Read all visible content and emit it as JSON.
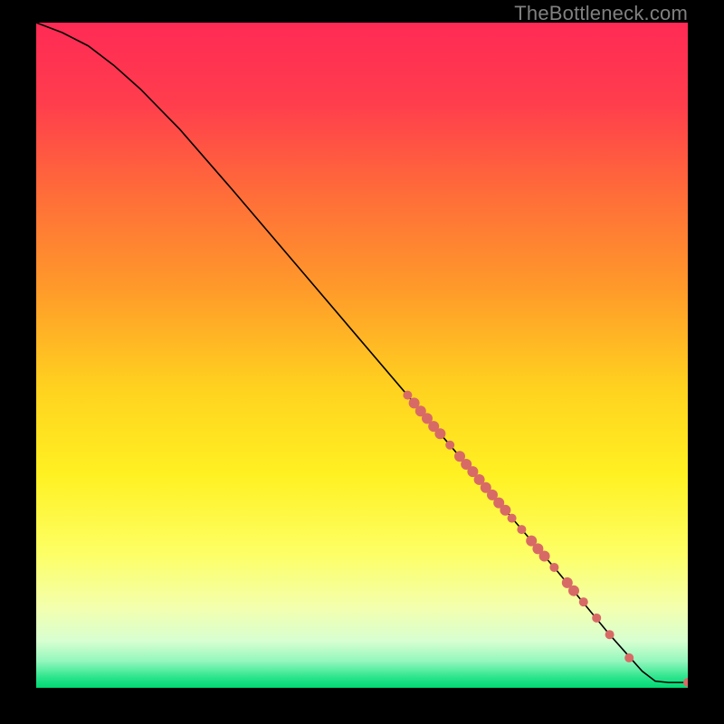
{
  "watermark": "TheBottleneck.com",
  "chart_data": {
    "type": "line",
    "xlim": [
      0,
      100
    ],
    "ylim": [
      0,
      100
    ],
    "title": "",
    "xlabel": "",
    "ylabel": "",
    "curve": [
      {
        "x": 0,
        "y": 100
      },
      {
        "x": 4,
        "y": 98.5
      },
      {
        "x": 8,
        "y": 96.5
      },
      {
        "x": 12,
        "y": 93.5
      },
      {
        "x": 16,
        "y": 90.0
      },
      {
        "x": 22,
        "y": 84.0
      },
      {
        "x": 30,
        "y": 75.0
      },
      {
        "x": 40,
        "y": 63.5
      },
      {
        "x": 50,
        "y": 52.0
      },
      {
        "x": 60,
        "y": 40.5
      },
      {
        "x": 70,
        "y": 29.0
      },
      {
        "x": 80,
        "y": 17.5
      },
      {
        "x": 88,
        "y": 8.0
      },
      {
        "x": 93,
        "y": 2.5
      },
      {
        "x": 95,
        "y": 1.0
      },
      {
        "x": 97,
        "y": 0.8
      },
      {
        "x": 100,
        "y": 0.8
      }
    ],
    "markers": [
      {
        "x": 57.0,
        "y": 44.0,
        "r": 5
      },
      {
        "x": 58.0,
        "y": 42.8,
        "r": 6
      },
      {
        "x": 59.0,
        "y": 41.6,
        "r": 6
      },
      {
        "x": 60.0,
        "y": 40.5,
        "r": 6
      },
      {
        "x": 61.0,
        "y": 39.3,
        "r": 6
      },
      {
        "x": 62.0,
        "y": 38.2,
        "r": 6
      },
      {
        "x": 63.5,
        "y": 36.5,
        "r": 5
      },
      {
        "x": 65.0,
        "y": 34.8,
        "r": 6
      },
      {
        "x": 66.0,
        "y": 33.6,
        "r": 6
      },
      {
        "x": 67.0,
        "y": 32.5,
        "r": 6
      },
      {
        "x": 68.0,
        "y": 31.3,
        "r": 6
      },
      {
        "x": 69.0,
        "y": 30.1,
        "r": 6
      },
      {
        "x": 70.0,
        "y": 29.0,
        "r": 6
      },
      {
        "x": 71.0,
        "y": 27.8,
        "r": 6
      },
      {
        "x": 72.0,
        "y": 26.7,
        "r": 6
      },
      {
        "x": 73.0,
        "y": 25.5,
        "r": 5
      },
      {
        "x": 74.5,
        "y": 23.8,
        "r": 5
      },
      {
        "x": 76.0,
        "y": 22.1,
        "r": 6
      },
      {
        "x": 77.0,
        "y": 20.9,
        "r": 6
      },
      {
        "x": 78.0,
        "y": 19.8,
        "r": 6
      },
      {
        "x": 79.5,
        "y": 18.1,
        "r": 5
      },
      {
        "x": 81.5,
        "y": 15.8,
        "r": 6
      },
      {
        "x": 82.5,
        "y": 14.6,
        "r": 6
      },
      {
        "x": 84.0,
        "y": 12.9,
        "r": 5
      },
      {
        "x": 86.0,
        "y": 10.5,
        "r": 5
      },
      {
        "x": 88.0,
        "y": 8.0,
        "r": 5
      },
      {
        "x": 91.0,
        "y": 4.5,
        "r": 5
      },
      {
        "x": 100.0,
        "y": 0.8,
        "r": 5
      }
    ],
    "gradient_stops": [
      {
        "p": 0.0,
        "c": "#ff2a55"
      },
      {
        "p": 0.12,
        "c": "#ff3d4d"
      },
      {
        "p": 0.25,
        "c": "#ff6a3a"
      },
      {
        "p": 0.4,
        "c": "#ff9a2a"
      },
      {
        "p": 0.55,
        "c": "#ffd21f"
      },
      {
        "p": 0.68,
        "c": "#fff122"
      },
      {
        "p": 0.8,
        "c": "#fdff66"
      },
      {
        "p": 0.88,
        "c": "#f3ffae"
      },
      {
        "p": 0.93,
        "c": "#d7ffd1"
      },
      {
        "p": 0.96,
        "c": "#93f7bd"
      },
      {
        "p": 0.985,
        "c": "#29e48b"
      },
      {
        "p": 1.0,
        "c": "#00d973"
      }
    ],
    "marker_color": "#d86a66",
    "line_color": "#000000"
  }
}
